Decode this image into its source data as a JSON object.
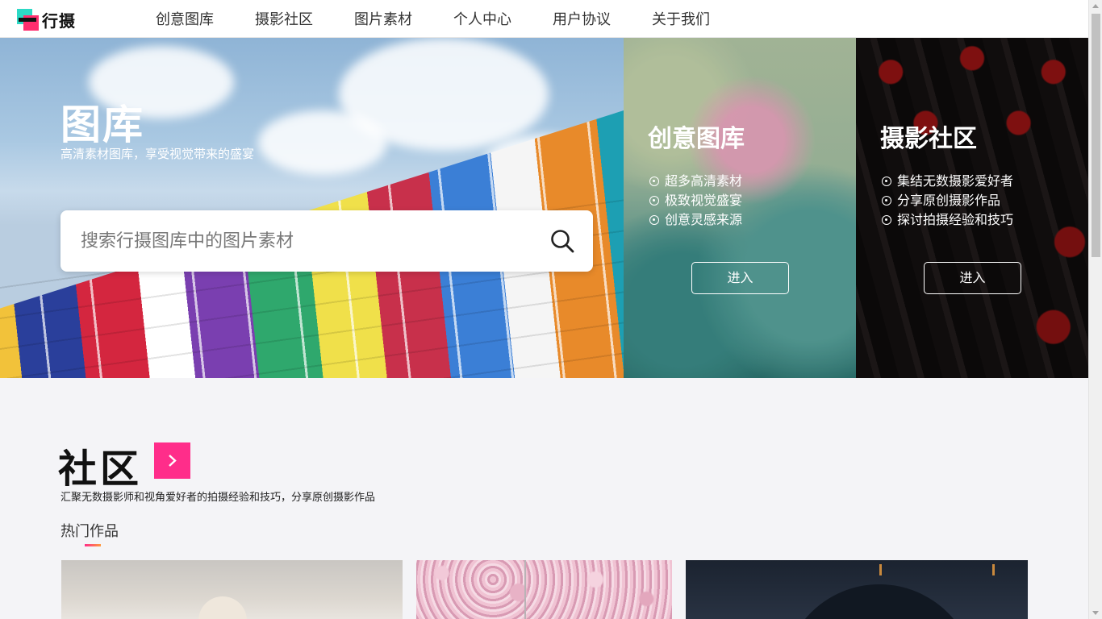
{
  "brand": {
    "name": "行摄"
  },
  "nav": {
    "items": [
      {
        "label": "创意图库"
      },
      {
        "label": "摄影社区"
      },
      {
        "label": "图片素材"
      },
      {
        "label": "个人中心"
      },
      {
        "label": "用户协议"
      },
      {
        "label": "关于我们"
      }
    ]
  },
  "hero": {
    "title": "图库",
    "subtitle": "高清素材图库，享受视觉带来的盛宴",
    "search_placeholder": "搜索行摄图库中的图片素材"
  },
  "panels": {
    "creative": {
      "title": "创意图库",
      "features": [
        "超多高清素材",
        "极致视觉盛宴",
        "创意灵感来源"
      ],
      "button": "进入"
    },
    "community": {
      "title": "摄影社区",
      "features": [
        "集结无数摄影爱好者",
        "分享原创摄影作品",
        "探讨拍摄经验和技巧"
      ],
      "button": "进入"
    }
  },
  "community_section": {
    "title": "社区",
    "description": "汇聚无数摄影师和视角爱好者的拍摄经验和技巧，分享原创摄影作品",
    "hot_title": "热门作品"
  },
  "colors": {
    "accent": "#ff2d8a",
    "logo_teal": "#2cd9c5",
    "logo_pink": "#ff2e6e"
  }
}
